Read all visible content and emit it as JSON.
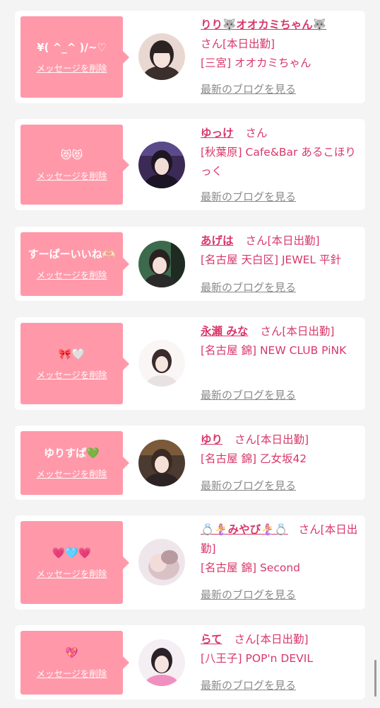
{
  "cards": [
    {
      "message": "¥( ^_^ )/~♡",
      "delete_label": "メッセージを削除",
      "name": "りり🐺オオカミちゃん🐺",
      "after_name": "さん[本日出勤]",
      "shop": "[三宮] オオカミちゃん",
      "blog_label": "最新のブログを見る"
    },
    {
      "message": "😻😻",
      "delete_label": "メッセージを削除",
      "name": "ゆっけ",
      "after_name": "さん",
      "shop": "[秋葉原] Cafe&Bar あるこほりっく",
      "blog_label": "最新のブログを見る"
    },
    {
      "message": "すーぱーいいね🫶🏻",
      "delete_label": "メッセージを削除",
      "name": "あげは",
      "after_name": "さん[本日出勤]",
      "shop": "[名古屋 天白区] JEWEL 平針",
      "blog_label": "最新のブログを見る"
    },
    {
      "message": "🎀🤍",
      "delete_label": "メッセージを削除",
      "name": "永瀬 みな",
      "after_name": "さん[本日出勤]",
      "shop": "[名古屋 錦] NEW CLUB PiNK",
      "blog_label": "最新のブログを見る"
    },
    {
      "message": "ゆりすぱ💚",
      "delete_label": "メッセージを削除",
      "name": "ゆり",
      "after_name": "さん[本日出勤]",
      "shop": "[名古屋 錦] 乙女坂42",
      "blog_label": "最新のブログを見る"
    },
    {
      "message": "💗🩵💗",
      "delete_label": "メッセージを削除",
      "name": "💍🧜‍♀️みやび🧜‍♀️💍",
      "after_name": "さん[本日出勤]",
      "shop": "[名古屋 錦] Second",
      "blog_label": "最新のブログを見る"
    },
    {
      "message": "💖",
      "delete_label": "メッセージを削除",
      "name": "らて",
      "after_name": "さん[本日出勤]",
      "shop": "[八王子] POP'n DEVIL",
      "blog_label": "最新のブログを見る"
    }
  ],
  "colors": {
    "accent": "#d8386a",
    "bubble": "#ff99aa",
    "muted": "#8a8a8a",
    "background": "#f4f4f4"
  }
}
